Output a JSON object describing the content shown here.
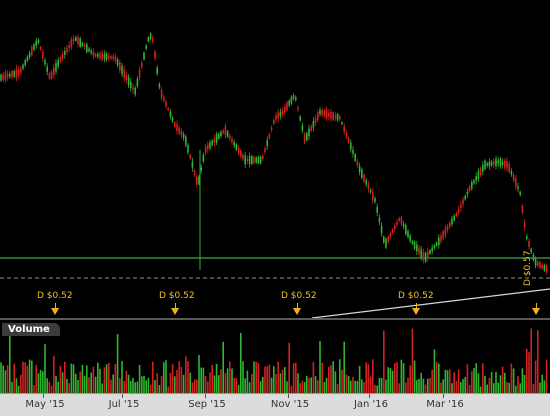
{
  "volume_label": "Volume",
  "x_axis": {
    "labels": [
      "May '15",
      "Jul '15",
      "Sep '15",
      "Nov '15",
      "Jan '16",
      "Mar '16"
    ]
  },
  "dividends": [
    {
      "label": "D $0.52"
    },
    {
      "label": "D $0.52"
    },
    {
      "label": "D $0.52"
    },
    {
      "label": "D $0.52"
    },
    {
      "label": "D $0.57"
    }
  ],
  "colors": {
    "up": "#2fb52f",
    "down": "#d02020",
    "support_line": "#3aa83a",
    "dashed_line": "#8a8a8a",
    "dividend": "#f0c020",
    "trend_line": "#d8d8d8"
  }
}
